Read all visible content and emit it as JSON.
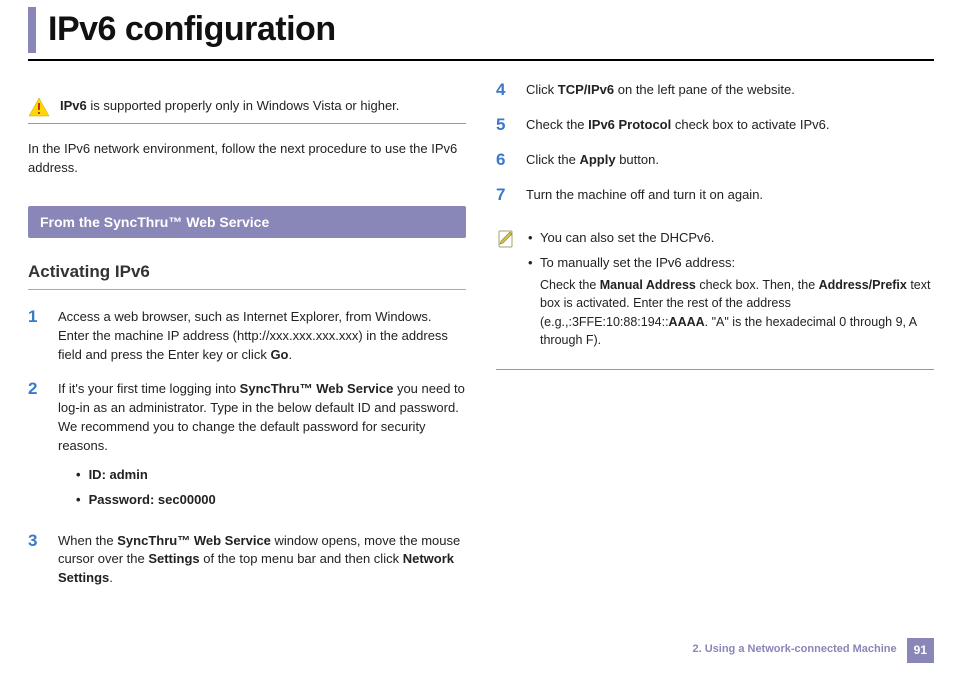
{
  "title": "IPv6 configuration",
  "warning": {
    "bold": "IPv6",
    "rest": " is supported properly only in Windows Vista or higher."
  },
  "intro": "In the IPv6 network environment, follow the next procedure to use the IPv6 address.",
  "section_banner": "From the SyncThru™ Web Service",
  "subheading": "Activating IPv6",
  "steps_left": [
    {
      "num": "1",
      "html": "Access a web browser, such as Internet Explorer, from Windows. Enter the machine IP address (http://xxx.xxx.xxx.xxx) in the address field and press the Enter key or click <b>Go</b>."
    },
    {
      "num": "2",
      "html": "If it's your first time logging into <b>SyncThru™ Web Service</b> you need to log-in as an administrator. Type in the below default ID and password. We recommend you to change the default password for security reasons.",
      "bullets": [
        "ID: admin",
        "Password: sec00000"
      ]
    },
    {
      "num": "3",
      "html": "When the <b>SyncThru™ Web Service</b> window opens, move the mouse cursor over the <b>Settings</b> of the top menu bar and then click <b>Network Settings</b>."
    }
  ],
  "steps_right": [
    {
      "num": "4",
      "html": "Click <b>TCP/IPv6</b> on the left pane of the website."
    },
    {
      "num": "5",
      "html": "Check the <b>IPv6 Protocol</b> check box to activate IPv6."
    },
    {
      "num": "6",
      "html": "Click the <b>Apply</b> button."
    },
    {
      "num": "7",
      "html": "Turn the machine off and turn it on again."
    }
  ],
  "note": {
    "items": [
      {
        "html": "You can also set the DHCPv6."
      },
      {
        "html": "To manually set the IPv6 address:",
        "sub_html": "Check the <b>Manual Address</b> check box. Then, the <b>Address/Prefix</b> text box is activated. Enter the rest of the address (e.g.,:3FFE:10:88:194::<b>AAAA</b>. \"A\" is the hexadecimal 0 through 9, A through F)."
      }
    ]
  },
  "footer": {
    "chapter": "2.  Using a Network-connected Machine",
    "page": "91"
  }
}
